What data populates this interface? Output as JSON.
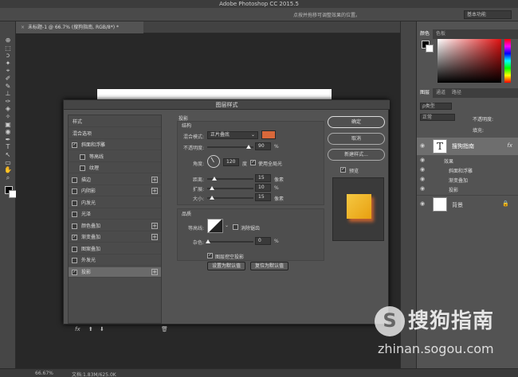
{
  "window": {
    "title": "Adobe Photoshop CC 2015.5"
  },
  "options_bar": {
    "hint": "点按并拖移可调整效果的位置。",
    "workspace": "基本功能"
  },
  "document": {
    "tab_label": "未标题-1 @ 66.7% (搜狗指南, RGB/8*) *",
    "close_glyph": "×"
  },
  "status_bar": {
    "zoom": "66.67%",
    "doc_info": "文档:1.83M/625.0K"
  },
  "tools": [
    "⊕",
    "⬚",
    "ↄ",
    "✦",
    "⌖",
    "✐",
    "✎",
    "⊥",
    "✑",
    "◈",
    "✧",
    "▣",
    "◉",
    "✒",
    "T",
    "↖",
    "▭",
    "✋",
    "⌕"
  ],
  "color_panel": {
    "tabs": [
      "颜色",
      "色板"
    ]
  },
  "layers_panel": {
    "tabs": [
      "图层",
      "通道",
      "路径"
    ],
    "filter": "ρ类型",
    "blend_mode": "正常",
    "opacity_label": "不透明度:",
    "fill_label": "填充:",
    "layers": [
      {
        "name": "搜狗指南",
        "thumb_glyph": "T",
        "fx": "fx",
        "effects_label": "效果",
        "effects": [
          "斜面和浮雕",
          "渐变叠加",
          "投影"
        ]
      },
      {
        "name": "背景",
        "lock_glyph": "🔒"
      }
    ]
  },
  "dialog": {
    "title": "图层样式",
    "styles": [
      {
        "label": "样式",
        "checkbox": false,
        "checked": false,
        "plus": false
      },
      {
        "label": "混合选项",
        "checkbox": false,
        "checked": false,
        "plus": false
      },
      {
        "label": "斜面和浮雕",
        "checkbox": true,
        "checked": true,
        "plus": false
      },
      {
        "label": "等高线",
        "checkbox": true,
        "checked": false,
        "plus": false,
        "indent": true
      },
      {
        "label": "纹理",
        "checkbox": true,
        "checked": false,
        "plus": false,
        "indent": true
      },
      {
        "label": "描边",
        "checkbox": true,
        "checked": false,
        "plus": true
      },
      {
        "label": "内阴影",
        "checkbox": true,
        "checked": false,
        "plus": true
      },
      {
        "label": "内发光",
        "checkbox": true,
        "checked": false,
        "plus": false
      },
      {
        "label": "光泽",
        "checkbox": true,
        "checked": false,
        "plus": false
      },
      {
        "label": "颜色叠加",
        "checkbox": true,
        "checked": false,
        "plus": true
      },
      {
        "label": "渐变叠加",
        "checkbox": true,
        "checked": true,
        "plus": true
      },
      {
        "label": "图案叠加",
        "checkbox": true,
        "checked": false,
        "plus": false
      },
      {
        "label": "外发光",
        "checkbox": true,
        "checked": false,
        "plus": false
      },
      {
        "label": "投影",
        "checkbox": true,
        "checked": true,
        "plus": true,
        "selected": true
      }
    ],
    "list_footer": {
      "fx": "fx",
      "up": "⬆",
      "down": "⬇",
      "trash": "🗑"
    },
    "shadow": {
      "section": "投影",
      "structure": "结构",
      "blend_mode_label": "混合模式:",
      "blend_mode": "正片叠底",
      "shadow_color": "#d8683a",
      "opacity_label": "不透明度:",
      "opacity": "90",
      "opacity_fraction": 0.9,
      "angle_label": "角度:",
      "angle": "120",
      "angle_unit": "度",
      "global_light_label": "使用全局光",
      "distance_label": "距离:",
      "distance": "15",
      "spread_label": "扩展:",
      "spread": "10",
      "size_label": "大小:",
      "size": "15",
      "px_unit": "像素",
      "percent_unit": "%",
      "quality": "品质",
      "contour_label": "等高线:",
      "antialias_label": "消除锯齿",
      "noise_label": "杂色:",
      "noise": "0",
      "knockout_label": "图层挖空投影",
      "set_default": "设置为默认值",
      "reset_default": "复位为默认值"
    },
    "buttons": {
      "ok": "确定",
      "cancel": "取消",
      "new_style": "新建样式...",
      "preview_label": "预览"
    }
  },
  "watermark": {
    "logo_glyph": "S",
    "name": "搜狗指南",
    "url": "zhinan.sogou.com"
  }
}
